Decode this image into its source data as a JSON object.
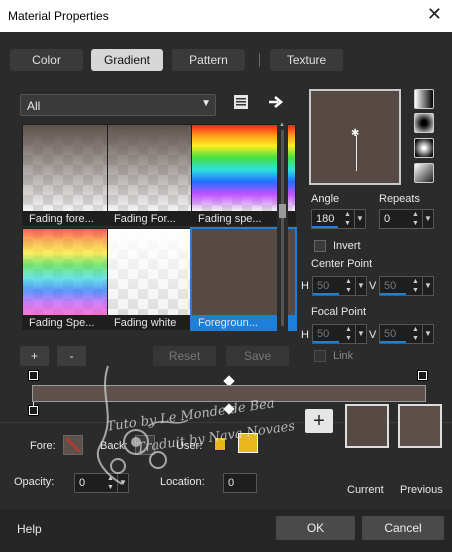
{
  "window": {
    "title": "Material Properties",
    "close_glyph": "✕"
  },
  "tabs": [
    {
      "label": "Color",
      "active": false
    },
    {
      "label": "Gradient",
      "active": true
    },
    {
      "label": "Pattern",
      "active": false
    },
    {
      "label": "Texture",
      "active": false
    }
  ],
  "category_select": {
    "value": "All"
  },
  "gradients": [
    {
      "label": "Fading fore...",
      "kind": "fade-fore",
      "selected": false
    },
    {
      "label": "Fading For...",
      "kind": "fade-fore",
      "selected": false
    },
    {
      "label": "Fading spe...",
      "kind": "spectrum-fade",
      "selected": false
    },
    {
      "label": "Fading Spe...",
      "kind": "spectrum",
      "selected": false
    },
    {
      "label": "Fading white",
      "kind": "fade-white",
      "selected": false
    },
    {
      "label": "Foregroun...",
      "kind": "solid",
      "selected": true
    }
  ],
  "list_buttons": {
    "add": "+",
    "remove": "-",
    "reset": "Reset",
    "save": "Save"
  },
  "angle": {
    "label": "Angle",
    "value": "180"
  },
  "repeats": {
    "label": "Repeats",
    "value": "0"
  },
  "invert": {
    "label": "Invert",
    "checked": false
  },
  "center_point": {
    "label": "Center Point",
    "h_label": "H",
    "h": "50",
    "v_label": "V",
    "v": "50"
  },
  "focal_point": {
    "label": "Focal Point",
    "h_label": "H",
    "h": "50",
    "v_label": "V",
    "v": "50"
  },
  "link": {
    "label": "Link",
    "checked": false
  },
  "stops": {
    "fore_label": "Fore:",
    "back_label": "Back:",
    "user_label": "User:",
    "opacity_label": "Opacity:",
    "opacity_value": "0",
    "location_label": "Location:",
    "location_value": "0"
  },
  "swatches": {
    "add_glyph": "+",
    "current_label": "Current",
    "previous_label": "Previous"
  },
  "watermark": {
    "line1": "Tuto by Le Monde de Bea",
    "line2": "Traduit by Nava Novaes"
  },
  "footer": {
    "help": "Help",
    "ok": "OK",
    "cancel": "Cancel"
  },
  "colors": {
    "gradient": "#574a44",
    "accent": "#1e7fd8",
    "user_swatch": "#e8b81a"
  },
  "icons": {
    "grad_types": [
      "linear-gradient-icon",
      "rectangular-gradient-icon",
      "radial-gradient-icon",
      "corner-gradient-icon"
    ]
  }
}
